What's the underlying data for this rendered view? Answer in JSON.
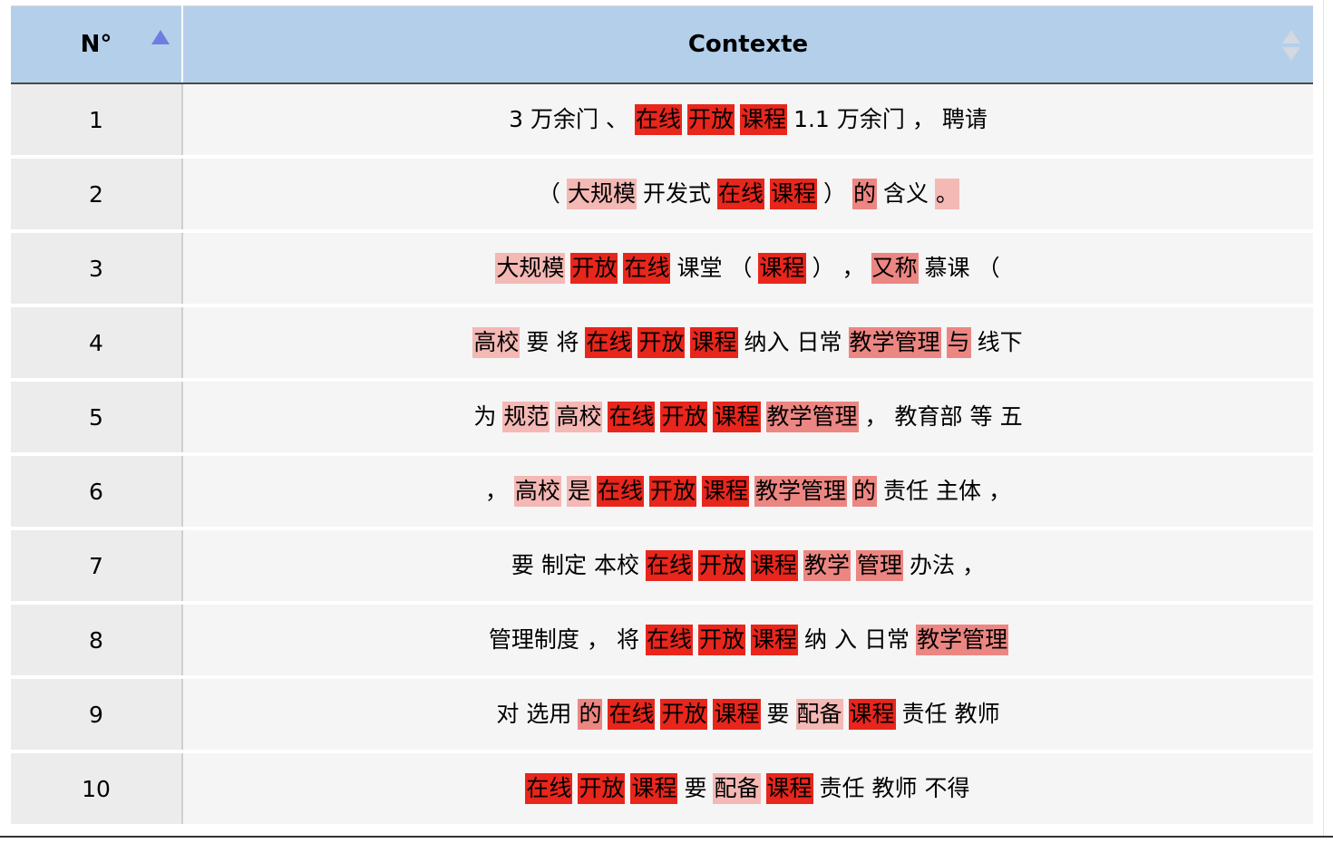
{
  "header": {
    "col1_label": "N°",
    "col2_label": "Contexte",
    "col1_sort_icon": "sort-ascending-icon",
    "col2_sort_icon": "sort-both-icon"
  },
  "highlight_colors": {
    "none": "transparent",
    "light": "#f4b8b5",
    "medium": "#ec8682",
    "strong": "#e8261c"
  },
  "rows": [
    {
      "n": "1",
      "tokens": [
        {
          "t": "3",
          "w": 0
        },
        {
          "t": "万余门",
          "w": 0
        },
        {
          "t": "、",
          "w": 0
        },
        {
          "t": "在线",
          "w": 3
        },
        {
          "t": "开放",
          "w": 3
        },
        {
          "t": "课程",
          "w": 3
        },
        {
          "t": "1.1",
          "w": 0
        },
        {
          "t": "万余门",
          "w": 0
        },
        {
          "t": "，",
          "w": 0
        },
        {
          "t": "聘请",
          "w": 0
        }
      ]
    },
    {
      "n": "2",
      "tokens": [
        {
          "t": "（",
          "w": 0
        },
        {
          "t": "大规模",
          "w": 1
        },
        {
          "t": "开发式",
          "w": 0
        },
        {
          "t": "在线",
          "w": 3
        },
        {
          "t": "课程",
          "w": 3
        },
        {
          "t": "）",
          "w": 0
        },
        {
          "t": "的",
          "w": 2
        },
        {
          "t": "含义",
          "w": 0
        },
        {
          "t": "。",
          "w": 1
        }
      ]
    },
    {
      "n": "3",
      "tokens": [
        {
          "t": "大规模",
          "w": 1
        },
        {
          "t": "开放",
          "w": 3
        },
        {
          "t": "在线",
          "w": 3
        },
        {
          "t": "课堂",
          "w": 0
        },
        {
          "t": "（",
          "w": 0
        },
        {
          "t": "课程",
          "w": 3
        },
        {
          "t": "）",
          "w": 0
        },
        {
          "t": "，",
          "w": 0
        },
        {
          "t": "又称",
          "w": 2
        },
        {
          "t": "慕课",
          "w": 0
        },
        {
          "t": "（",
          "w": 0
        }
      ]
    },
    {
      "n": "4",
      "tokens": [
        {
          "t": "高校",
          "w": 1
        },
        {
          "t": "要",
          "w": 0
        },
        {
          "t": "将",
          "w": 0
        },
        {
          "t": "在线",
          "w": 3
        },
        {
          "t": "开放",
          "w": 3
        },
        {
          "t": "课程",
          "w": 3
        },
        {
          "t": "纳入",
          "w": 0
        },
        {
          "t": "日常",
          "w": 0
        },
        {
          "t": "教学管理",
          "w": 2
        },
        {
          "t": "与",
          "w": 2
        },
        {
          "t": "线下",
          "w": 0
        }
      ]
    },
    {
      "n": "5",
      "tokens": [
        {
          "t": "为",
          "w": 0
        },
        {
          "t": "规范",
          "w": 1
        },
        {
          "t": "高校",
          "w": 1
        },
        {
          "t": "在线",
          "w": 3
        },
        {
          "t": "开放",
          "w": 3
        },
        {
          "t": "课程",
          "w": 3
        },
        {
          "t": "教学管理",
          "w": 2
        },
        {
          "t": "，",
          "w": 0
        },
        {
          "t": "教育部",
          "w": 0
        },
        {
          "t": "等",
          "w": 0
        },
        {
          "t": "五",
          "w": 0
        }
      ]
    },
    {
      "n": "6",
      "tokens": [
        {
          "t": "，",
          "w": 0
        },
        {
          "t": "高校",
          "w": 1
        },
        {
          "t": "是",
          "w": 1
        },
        {
          "t": "在线",
          "w": 3
        },
        {
          "t": "开放",
          "w": 3
        },
        {
          "t": "课程",
          "w": 3
        },
        {
          "t": "教学管理",
          "w": 2
        },
        {
          "t": "的",
          "w": 2
        },
        {
          "t": "责任",
          "w": 0
        },
        {
          "t": "主体",
          "w": 0
        },
        {
          "t": "，",
          "w": 0
        }
      ]
    },
    {
      "n": "7",
      "tokens": [
        {
          "t": "要",
          "w": 0
        },
        {
          "t": "制定",
          "w": 0
        },
        {
          "t": "本校",
          "w": 0
        },
        {
          "t": "在线",
          "w": 3
        },
        {
          "t": "开放",
          "w": 3
        },
        {
          "t": "课程",
          "w": 3
        },
        {
          "t": "教学",
          "w": 2
        },
        {
          "t": "管理",
          "w": 2
        },
        {
          "t": "办法",
          "w": 0
        },
        {
          "t": "，",
          "w": 0
        }
      ]
    },
    {
      "n": "8",
      "tokens": [
        {
          "t": "管理制度",
          "w": 0
        },
        {
          "t": "，",
          "w": 0
        },
        {
          "t": "将",
          "w": 0
        },
        {
          "t": "在线",
          "w": 3
        },
        {
          "t": "开放",
          "w": 3
        },
        {
          "t": "课程",
          "w": 3
        },
        {
          "t": "纳",
          "w": 0
        },
        {
          "t": "入",
          "w": 0
        },
        {
          "t": "日常",
          "w": 0
        },
        {
          "t": "教学管理",
          "w": 2
        }
      ]
    },
    {
      "n": "9",
      "tokens": [
        {
          "t": "对",
          "w": 0
        },
        {
          "t": "选用",
          "w": 0
        },
        {
          "t": "的",
          "w": 2
        },
        {
          "t": "在线",
          "w": 3
        },
        {
          "t": "开放",
          "w": 3
        },
        {
          "t": "课程",
          "w": 3
        },
        {
          "t": "要",
          "w": 0
        },
        {
          "t": "配备",
          "w": 1
        },
        {
          "t": "课程",
          "w": 3
        },
        {
          "t": "责任",
          "w": 0
        },
        {
          "t": "教师",
          "w": 0
        }
      ]
    },
    {
      "n": "10",
      "tokens": [
        {
          "t": "在线",
          "w": 3
        },
        {
          "t": "开放",
          "w": 3
        },
        {
          "t": "课程",
          "w": 3
        },
        {
          "t": "要",
          "w": 0
        },
        {
          "t": "配备",
          "w": 1
        },
        {
          "t": "课程",
          "w": 3
        },
        {
          "t": "责任",
          "w": 0
        },
        {
          "t": "教师",
          "w": 0
        },
        {
          "t": "不得",
          "w": 0
        }
      ]
    }
  ]
}
